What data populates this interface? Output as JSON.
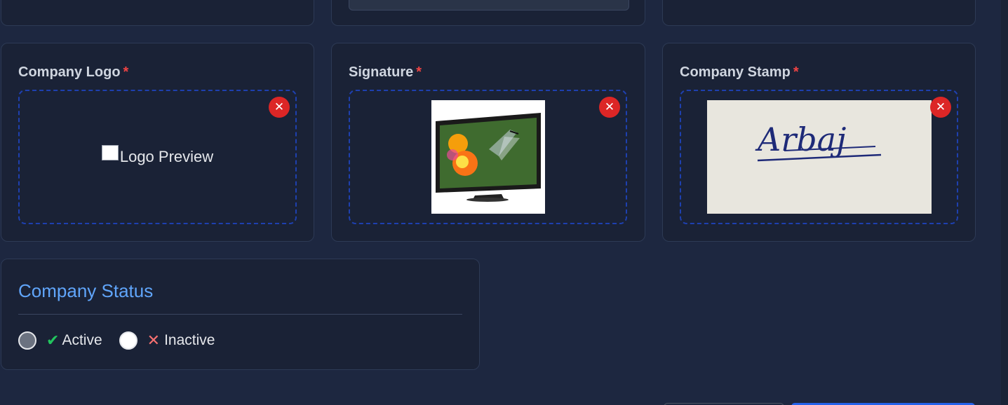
{
  "fields": {
    "logo": {
      "label": "Company Logo",
      "required_mark": "*",
      "preview_alt": "Logo Preview",
      "remove_icon": "close-icon"
    },
    "signature": {
      "label": "Signature",
      "required_mark": "*",
      "remove_icon": "close-icon"
    },
    "stamp": {
      "label": "Company Stamp",
      "required_mark": "*",
      "stamp_text": "Arbaj",
      "remove_icon": "close-icon"
    }
  },
  "status": {
    "title": "Company Status",
    "selected": "Active",
    "options": [
      {
        "label": "Active",
        "icon": "check-icon"
      },
      {
        "label": "Inactive",
        "icon": "x-icon"
      }
    ]
  },
  "colors": {
    "accent": "#60a5fa",
    "danger": "#dc2626",
    "required": "#ef4444",
    "active": "#22c55e",
    "inactive": "#f87171",
    "dropzone_border": "#1e40af"
  }
}
